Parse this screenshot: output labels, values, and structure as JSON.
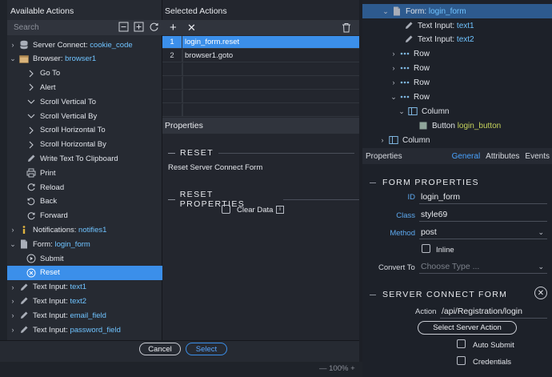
{
  "dialog": {
    "available_actions_title": "Available Actions",
    "search_placeholder": "Search",
    "actions": [
      {
        "label": "Server Connect:",
        "hl": "cookie_code",
        "icon": "database-icon",
        "chev": "›",
        "indent": 1
      },
      {
        "label": "Browser:",
        "hl": "browser1",
        "icon": "browser-icon",
        "chev": "⌄",
        "indent": 1
      },
      {
        "label": "Go To",
        "hl": "",
        "icon": "chevron-right-icon",
        "chev": "",
        "indent": 2
      },
      {
        "label": "Alert",
        "hl": "",
        "icon": "chevron-right-icon",
        "chev": "",
        "indent": 2
      },
      {
        "label": "Scroll Vertical To",
        "hl": "",
        "icon": "chevron-down-icon",
        "chev": "",
        "indent": 2
      },
      {
        "label": "Scroll Vertical By",
        "hl": "",
        "icon": "chevron-down-icon",
        "chev": "",
        "indent": 2
      },
      {
        "label": "Scroll Horizontal To",
        "hl": "",
        "icon": "chevron-right-icon",
        "chev": "",
        "indent": 2
      },
      {
        "label": "Scroll Horizontal By",
        "hl": "",
        "icon": "chevron-right-icon",
        "chev": "",
        "indent": 2
      },
      {
        "label": "Write Text To Clipboard",
        "hl": "",
        "icon": "pencil-icon",
        "chev": "",
        "indent": 2
      },
      {
        "label": "Print",
        "hl": "",
        "icon": "print-icon",
        "chev": "",
        "indent": 2
      },
      {
        "label": "Reload",
        "hl": "",
        "icon": "reload-icon",
        "chev": "",
        "indent": 2
      },
      {
        "label": "Back",
        "hl": "",
        "icon": "back-icon",
        "chev": "",
        "indent": 2
      },
      {
        "label": "Forward",
        "hl": "",
        "icon": "forward-icon",
        "chev": "",
        "indent": 2
      },
      {
        "label": "Notifications:",
        "hl": "notifies1",
        "icon": "info-icon",
        "chev": "›",
        "indent": 1
      },
      {
        "label": "Form:",
        "hl": "login_form",
        "icon": "form-icon",
        "chev": "⌄",
        "indent": 1
      },
      {
        "label": "Submit",
        "hl": "",
        "icon": "play-circle-icon",
        "chev": "",
        "indent": 2
      },
      {
        "label": "Reset",
        "hl": "",
        "icon": "close-circle-icon",
        "chev": "",
        "indent": 2,
        "selected": true
      },
      {
        "label": "Text Input:",
        "hl": "text1",
        "icon": "pencil-icon",
        "chev": "›",
        "indent": 1
      },
      {
        "label": "Text Input:",
        "hl": "text2",
        "icon": "pencil-icon",
        "chev": "›",
        "indent": 1
      },
      {
        "label": "Text Input:",
        "hl": "email_field",
        "icon": "pencil-icon",
        "chev": "›",
        "indent": 1
      },
      {
        "label": "Text Input:",
        "hl": "password_field",
        "icon": "pencil-icon",
        "chev": "›",
        "indent": 1
      }
    ],
    "selected_actions_title": "Selected Actions",
    "selected_actions": [
      {
        "num": "1",
        "text": "login_form.reset",
        "selected": true
      },
      {
        "num": "2",
        "text": "browser1.goto",
        "selected": false
      }
    ],
    "properties_title": "Properties",
    "reset_section": "RESET",
    "reset_description": "Reset Server Connect Form",
    "reset_properties_section": "RESET PROPERTIES",
    "clear_data_label": "Clear Data",
    "cancel_label": "Cancel",
    "select_label": "Select"
  },
  "status": {
    "zoom": "— 100% +"
  },
  "tree": [
    {
      "chev": "⌄",
      "icon": "form-icon",
      "label": "Form:",
      "hl": "login_form",
      "selected": true
    },
    {
      "chev": "",
      "icon": "pencil-icon",
      "label": "Text Input:",
      "hl": "text1"
    },
    {
      "chev": "",
      "icon": "pencil-icon",
      "label": "Text Input:",
      "hl": "text2"
    },
    {
      "chev": "›",
      "icon": "row-icon",
      "label": "Row",
      "hl": ""
    },
    {
      "chev": "›",
      "icon": "row-icon",
      "label": "Row",
      "hl": ""
    },
    {
      "chev": "›",
      "icon": "row-icon",
      "label": "Row",
      "hl": ""
    },
    {
      "chev": "⌄",
      "icon": "row-icon",
      "label": "Row",
      "hl": ""
    },
    {
      "chev": "⌄",
      "icon": "column-icon",
      "label": "Column",
      "hl": ""
    },
    {
      "chev": "",
      "icon": "button-icon",
      "label": "Button",
      "hl": "login_button",
      "green": true
    },
    {
      "chev": "›",
      "icon": "column-icon",
      "label": "Column",
      "hl": ""
    }
  ],
  "props": {
    "title": "Properties",
    "tabs": [
      "General",
      "Attributes",
      "Events"
    ],
    "form_properties": "FORM PROPERTIES",
    "id_label": "ID",
    "id_value": "login_form",
    "class_label": "Class",
    "class_value": "style69",
    "method_label": "Method",
    "method_value": "post",
    "inline_label": "Inline",
    "convert_label": "Convert To",
    "convert_placeholder": "Choose Type ...",
    "server_connect_form": "SERVER CONNECT FORM",
    "action_label": "Action",
    "action_value": "/api/Registration/login",
    "select_server_action": "Select Server Action",
    "auto_submit_label": "Auto Submit",
    "credentials_label": "Credentials"
  },
  "colors": {
    "accent": "#3b8fea",
    "highlight_text": "#6fc3ff",
    "green_text": "#c6d35b"
  }
}
